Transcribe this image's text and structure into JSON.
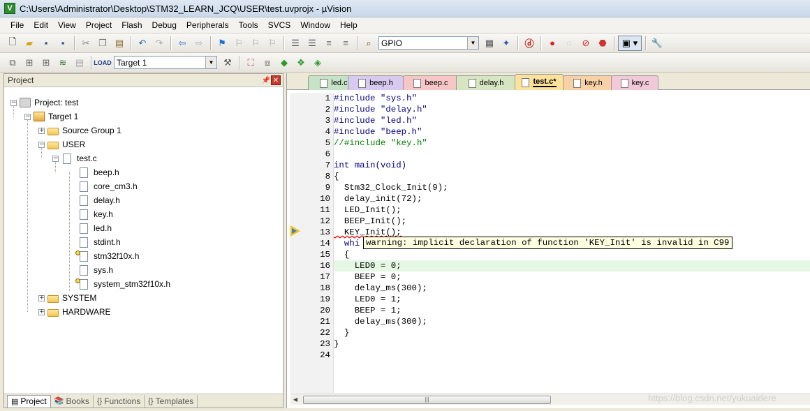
{
  "window": {
    "title": "C:\\Users\\Administrator\\Desktop\\STM32_LEARN_JCQ\\USER\\test.uvprojx - µVision"
  },
  "menu": [
    "File",
    "Edit",
    "View",
    "Project",
    "Flash",
    "Debug",
    "Peripherals",
    "Tools",
    "SVCS",
    "Window",
    "Help"
  ],
  "toolbar": {
    "find_combo": "GPIO",
    "target_combo": "Target 1"
  },
  "project_pane": {
    "title": "Project",
    "tree": {
      "project": "Project: test",
      "target": "Target 1",
      "source_group": "Source Group 1",
      "user": "USER",
      "test_c": "test.c",
      "headers": [
        "beep.h",
        "core_cm3.h",
        "delay.h",
        "key.h",
        "led.h",
        "stdint.h",
        "stm32f10x.h",
        "sys.h",
        "system_stm32f10x.h"
      ],
      "system": "SYSTEM",
      "hardware": "HARDWARE"
    },
    "tabs": [
      "Project",
      "Books",
      "Functions",
      "Templates"
    ]
  },
  "editor": {
    "tabs": [
      {
        "label": "led.c",
        "color": "#c7e3c7"
      },
      {
        "label": "beep.h",
        "color": "#d7c9ef"
      },
      {
        "label": "beep.c",
        "color": "#f7c7c7"
      },
      {
        "label": "delay.h",
        "color": "#d6e6c2"
      },
      {
        "label": "test.c*",
        "color": "#fde29b"
      },
      {
        "label": "key.h",
        "color": "#f8d2a6"
      },
      {
        "label": "key.c",
        "color": "#f2c9d8"
      }
    ],
    "line_numbers": [
      "1",
      "2",
      "3",
      "4",
      "5",
      "6",
      "7",
      "8",
      "9",
      "10",
      "11",
      "12",
      "13",
      "14",
      "15",
      "16",
      "17",
      "18",
      "19",
      "20",
      "21",
      "22",
      "23",
      "24"
    ],
    "code": {
      "l1": "#include \"sys.h\"",
      "l2": "#include \"delay.h\"",
      "l3": "#include \"led.h\"",
      "l4": "#include \"beep.h\"",
      "l5": "//#include \"key.h\"",
      "l7": "int main(void)",
      "l8": "{",
      "l9": "  Stm32_Clock_Init(9);",
      "l10": "  delay_init(72);",
      "l11": "  LED_Init();",
      "l12": "  BEEP_Init();",
      "l13": "  KEY_Init();",
      "l14": "  whi",
      "l15": "  {",
      "l16": "    LED0 = 0;",
      "l17": "    BEEP = 0;",
      "l18": "    delay_ms(300);",
      "l19": "    LED0 = 1;",
      "l20": "    BEEP = 1;",
      "l21": "    delay_ms(300);",
      "l22": "  }",
      "l23": "}"
    },
    "tooltip": "warning: implicit declaration of function 'KEY_Init' is invalid in C99"
  },
  "watermark": "https://blog.csdn.net/yukuaidere"
}
